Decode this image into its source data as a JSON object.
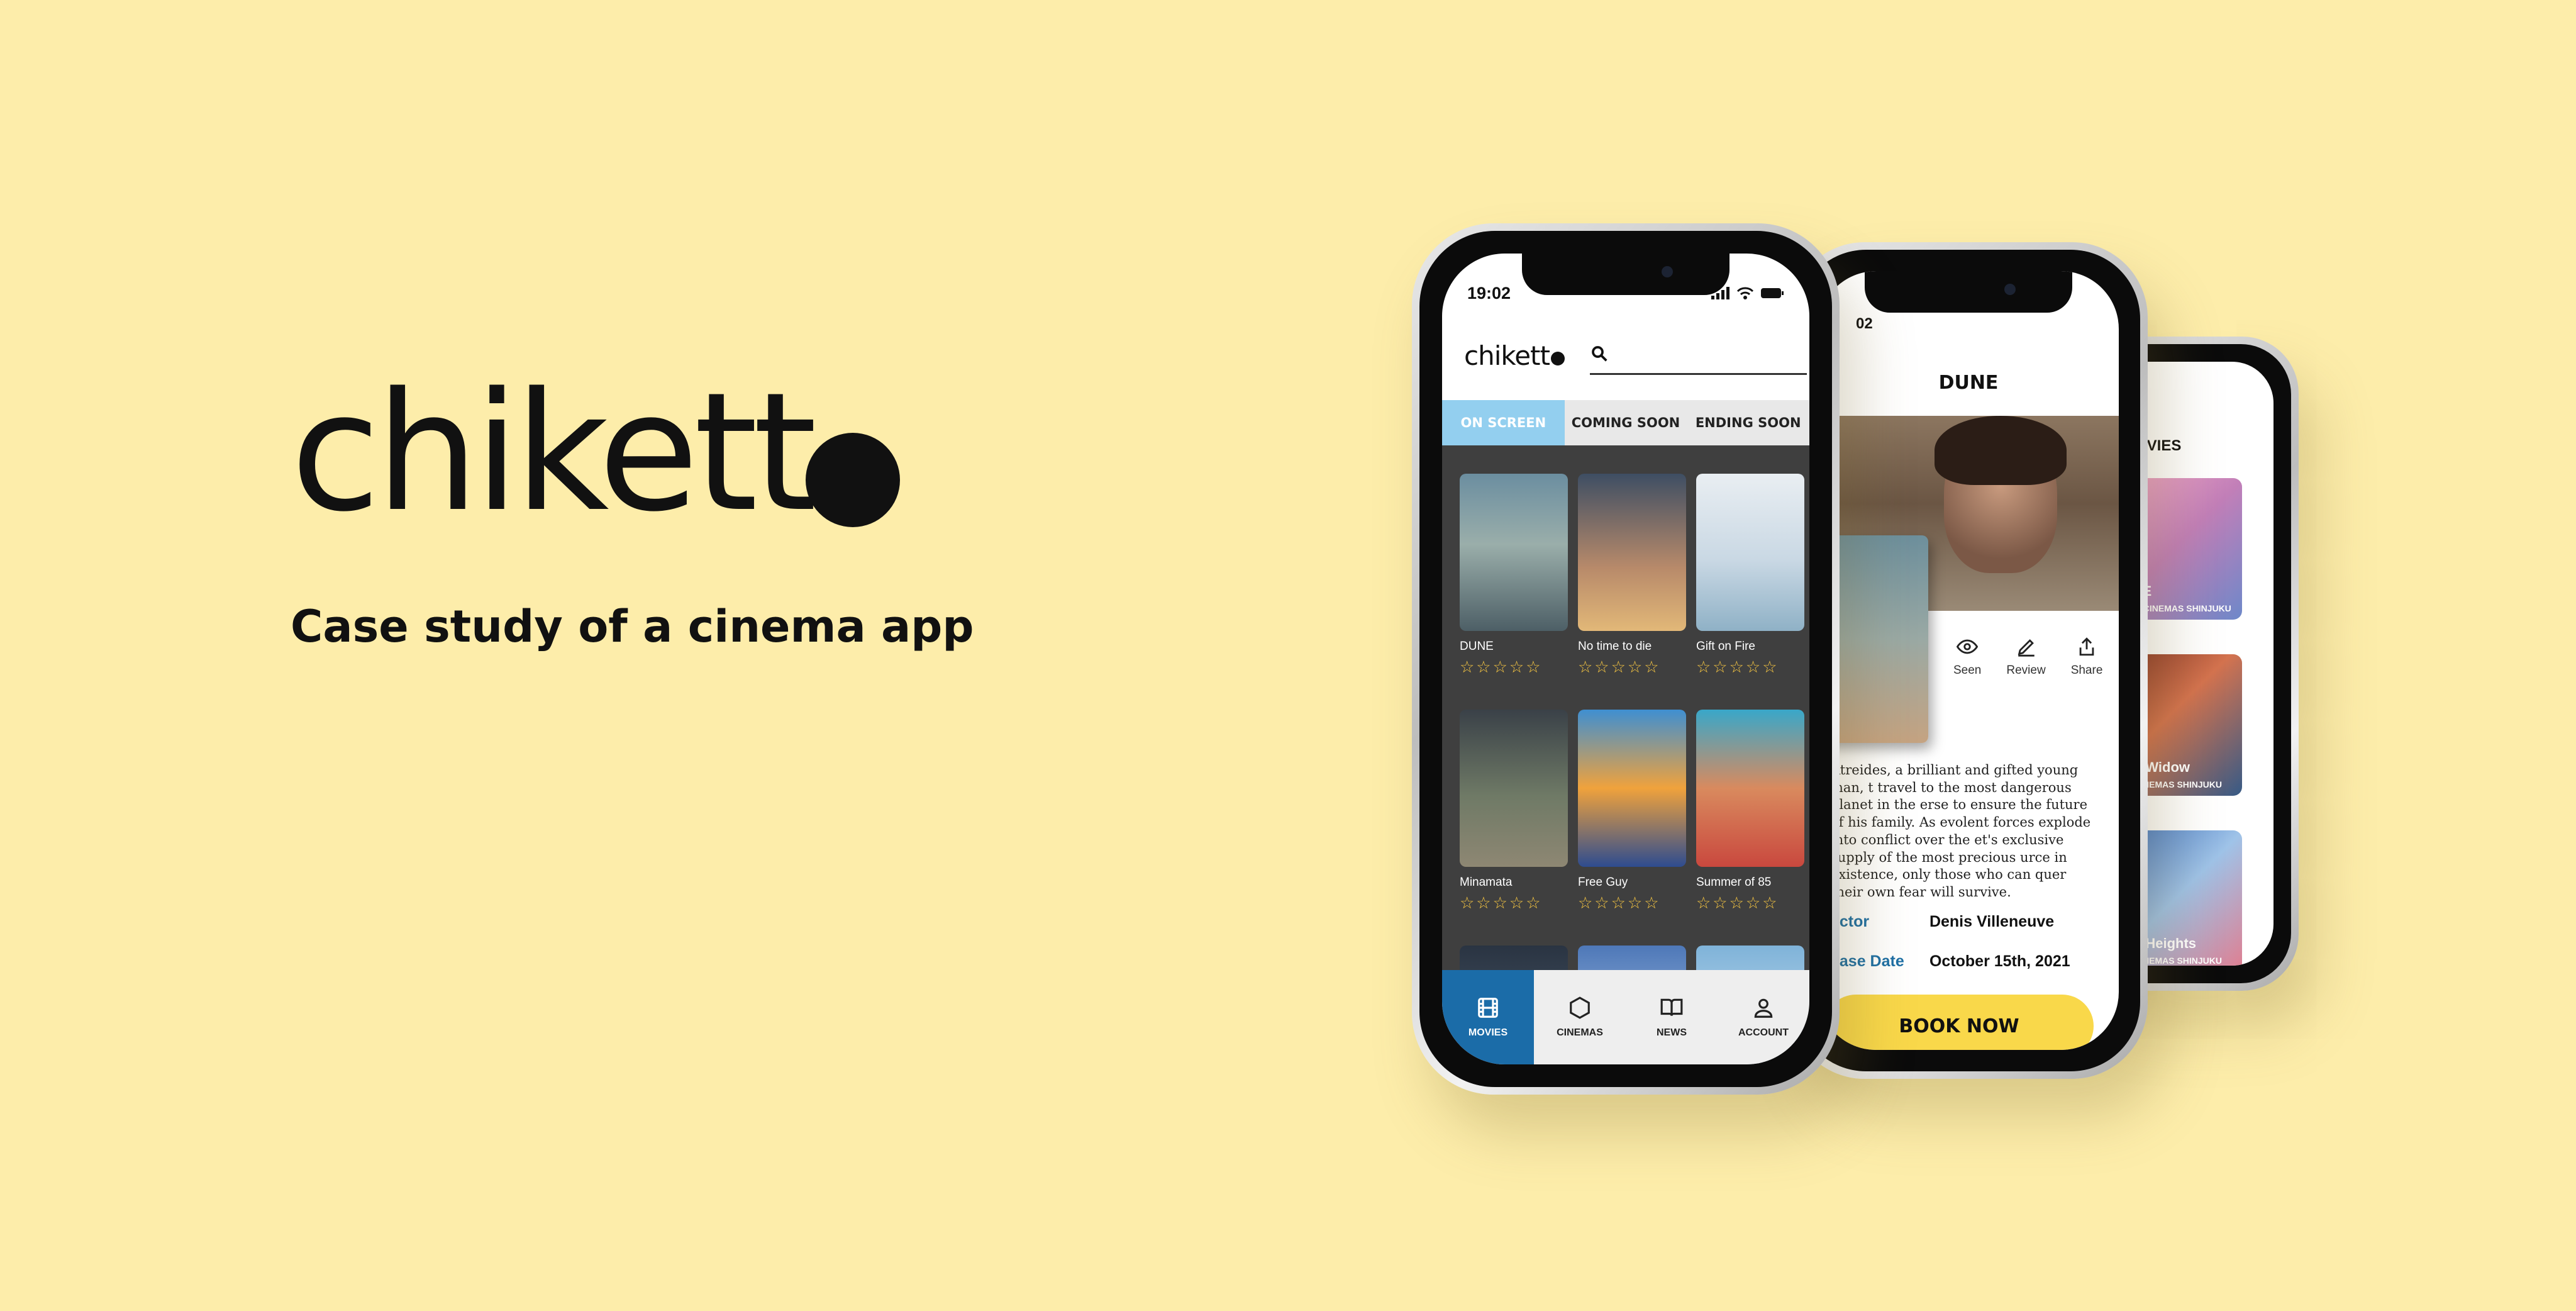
{
  "brand": {
    "logo_text": "chikett",
    "tagline": "Case study of a cinema app"
  },
  "colors": {
    "background": "#FDEDAA",
    "accent_blue": "#1B6CA8",
    "tab_active": "#93CFEF",
    "book_button": "#F9D84A",
    "stars": "#F5C542"
  },
  "phone_main": {
    "time": "19:02",
    "logo": "chikett",
    "search": {
      "placeholder": "",
      "value": "",
      "icon": "search-icon"
    },
    "tabs": [
      {
        "label": "ON SCREEN",
        "active": true
      },
      {
        "label": "COMING SOON",
        "active": false
      },
      {
        "label": "ENDING SOON",
        "active": false
      }
    ],
    "movies": [
      {
        "title": "DUNE",
        "rating": 0
      },
      {
        "title": "No time to die",
        "rating": 0
      },
      {
        "title": "Gift on Fire",
        "rating": 0
      },
      {
        "title": "Minamata",
        "rating": 0
      },
      {
        "title": "Free Guy",
        "rating": 0
      },
      {
        "title": "Summer of 85",
        "rating": 0
      }
    ],
    "stars": "☆☆☆☆☆",
    "nav": [
      {
        "label": "MOVIES",
        "icon": "film-icon",
        "active": true
      },
      {
        "label": "CINEMAS",
        "icon": "hexagon-icon",
        "active": false
      },
      {
        "label": "NEWS",
        "icon": "book-icon",
        "active": false
      },
      {
        "label": "ACCOUNT",
        "icon": "user-icon",
        "active": false
      }
    ]
  },
  "phone_detail": {
    "time": "02",
    "title": "DUNE",
    "actions": [
      {
        "label": "Seen",
        "icon": "eye-icon"
      },
      {
        "label": "Review",
        "icon": "pencil-icon"
      },
      {
        "label": "Share",
        "icon": "share-icon"
      }
    ],
    "synopsis": "Atreides, a brilliant and gifted young man, t travel to the most dangerous planet in the erse to ensure the future of his family. As evolent forces explode into conflict over the et's exclusive supply of the most precious urce in existence, only those who can quer their own fear will survive.",
    "director_label": "ector",
    "director_value": "Denis Villeneuve",
    "release_label": "ease Date",
    "release_value": "October 15th, 2021",
    "book_label": "BOOK NOW"
  },
  "phone_list": {
    "title": "MOVIES",
    "items": [
      {
        "name": "LE",
        "sub": "O CINEMAS SHINJUKU"
      },
      {
        "name": "k Widow",
        "sub": "CINEMAS SHINJUKU"
      },
      {
        "name": "e Heights",
        "sub": "CINEMAS SHINJUKU"
      }
    ]
  }
}
